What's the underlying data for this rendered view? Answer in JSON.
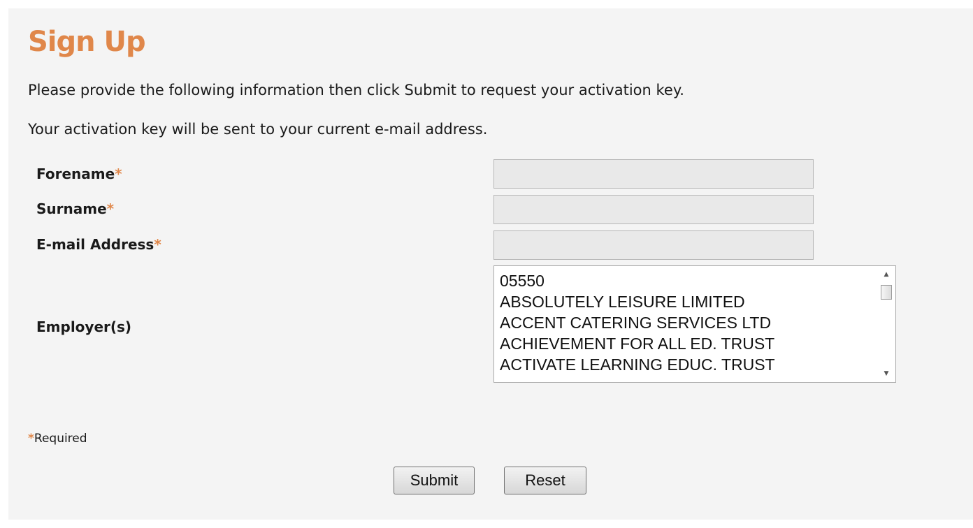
{
  "page": {
    "title": "Sign Up",
    "intro_line_1": "Please provide the following information then click Submit to request your activation key.",
    "intro_line_2": "Your activation key will be sent to your current e-mail address."
  },
  "form": {
    "forename": {
      "label": "Forename",
      "required_marker": "*",
      "value": ""
    },
    "surname": {
      "label": "Surname",
      "required_marker": "*",
      "value": ""
    },
    "email": {
      "label": "E-mail Address",
      "required_marker": "*",
      "value": ""
    },
    "employer": {
      "label": "Employer(s)",
      "options": [
        "05550",
        "ABSOLUTELY LEISURE LIMITED",
        "ACCENT CATERING SERVICES LTD",
        "ACHIEVEMENT FOR ALL ED. TRUST",
        "ACTIVATE LEARNING EDUC. TRUST"
      ],
      "scroll_up_icon": "scroll-up-arrow",
      "scroll_down_icon": "scroll-down-arrow"
    }
  },
  "required_note": {
    "marker": "*",
    "text": "Required"
  },
  "buttons": {
    "submit_label": "Submit",
    "reset_label": "Reset"
  },
  "colors": {
    "accent": "#e0874a",
    "panel_background": "#f4f4f4",
    "input_background": "#e9e9e9"
  }
}
